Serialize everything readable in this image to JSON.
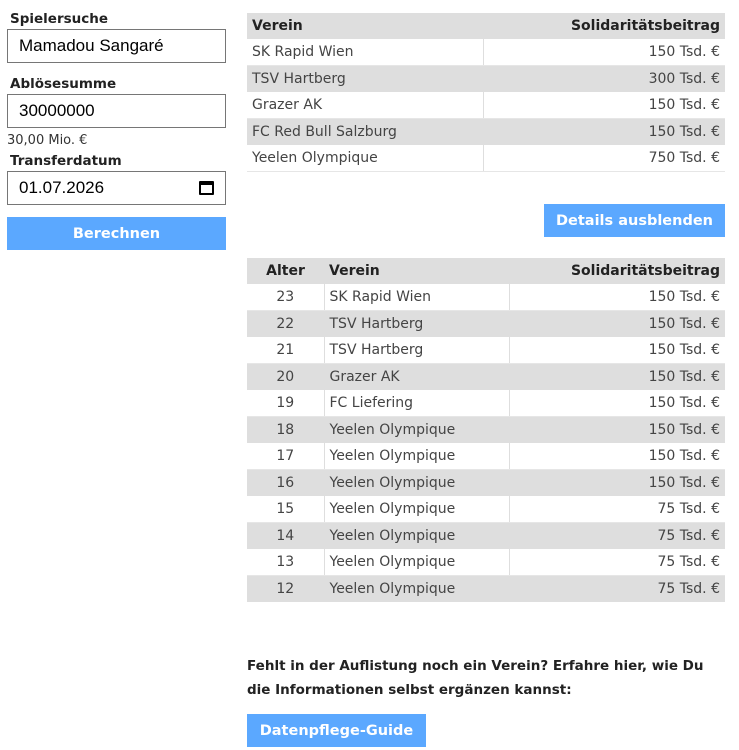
{
  "form": {
    "player_label": "Spielersuche",
    "player_value": "Mamadou Sangaré",
    "fee_label": "Ablösesumme",
    "fee_value": "30000000",
    "fee_hint": "30,00 Mio. €",
    "date_label": "Transferdatum",
    "date_value": "01.07.2026",
    "calc_button": "Berechnen"
  },
  "summary_table": {
    "headers": [
      "Verein",
      "Solidaritätsbeitrag"
    ],
    "rows": [
      {
        "club": "SK Rapid Wien",
        "amount": "150 Tsd. €"
      },
      {
        "club": "TSV Hartberg",
        "amount": "300 Tsd. €"
      },
      {
        "club": "Grazer AK",
        "amount": "150 Tsd. €"
      },
      {
        "club": "FC Red Bull Salzburg",
        "amount": "150 Tsd. €"
      },
      {
        "club": "Yeelen Olympique",
        "amount": "750 Tsd. €"
      }
    ]
  },
  "toggle_button": "Details ausblenden",
  "detail_table": {
    "headers": [
      "Alter",
      "Verein",
      "Solidaritätsbeitrag"
    ],
    "rows": [
      {
        "age": "23",
        "club": "SK Rapid Wien",
        "amount": "150 Tsd. €"
      },
      {
        "age": "22",
        "club": "TSV Hartberg",
        "amount": "150 Tsd. €"
      },
      {
        "age": "21",
        "club": "TSV Hartberg",
        "amount": "150 Tsd. €"
      },
      {
        "age": "20",
        "club": "Grazer AK",
        "amount": "150 Tsd. €"
      },
      {
        "age": "19",
        "club": "FC Liefering",
        "amount": "150 Tsd. €"
      },
      {
        "age": "18",
        "club": "Yeelen Olympique",
        "amount": "150 Tsd. €"
      },
      {
        "age": "17",
        "club": "Yeelen Olympique",
        "amount": "150 Tsd. €"
      },
      {
        "age": "16",
        "club": "Yeelen Olympique",
        "amount": "150 Tsd. €"
      },
      {
        "age": "15",
        "club": "Yeelen Olympique",
        "amount": "75 Tsd. €"
      },
      {
        "age": "14",
        "club": "Yeelen Olympique",
        "amount": "75 Tsd. €"
      },
      {
        "age": "13",
        "club": "Yeelen Olympique",
        "amount": "75 Tsd. €"
      },
      {
        "age": "12",
        "club": "Yeelen Olympique",
        "amount": "75 Tsd. €"
      }
    ]
  },
  "note": "Fehlt in der Auflistung noch ein Verein? Erfahre hier, wie Du die Informationen selbst ergänzen kannst:",
  "guide_button": "Datenpflege-Guide",
  "colors": {
    "accent": "#5ba8ff",
    "row_alt": "#dedede"
  },
  "icons": {
    "date_picker": "calendar-icon"
  }
}
